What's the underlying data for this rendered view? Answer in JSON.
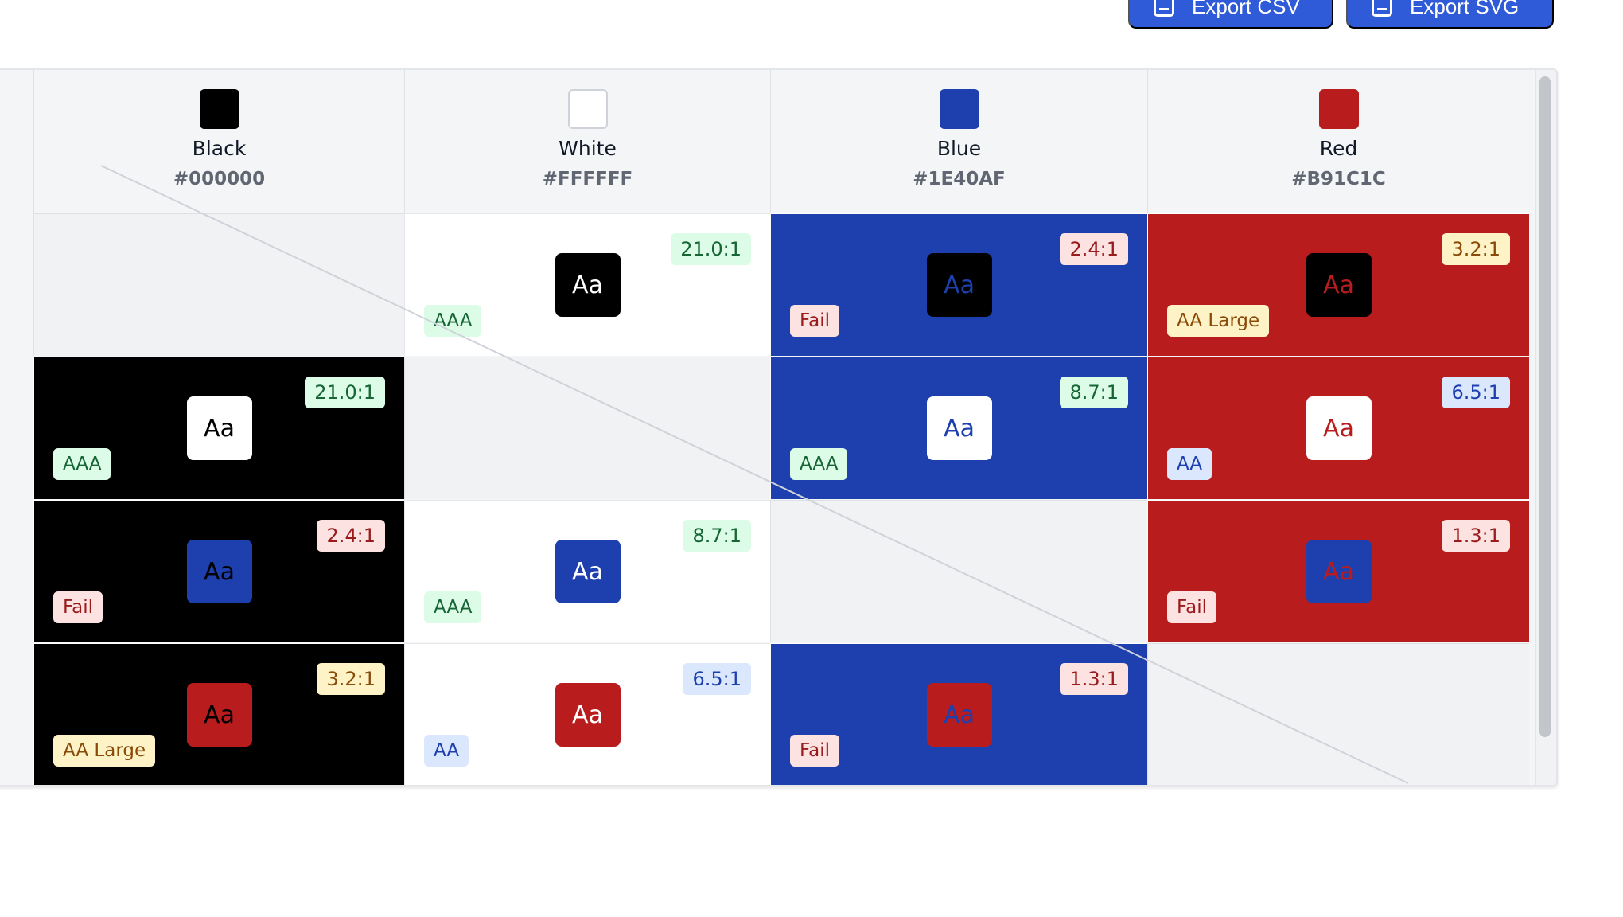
{
  "toolbar": {
    "export_csv_label": "Export CSV",
    "export_svg_label": "Export SVG"
  },
  "sample_text": "Aa",
  "columns": [
    {
      "name": "Black",
      "hex": "#000000"
    },
    {
      "name": "White",
      "hex": "#FFFFFF"
    },
    {
      "name": "Blue",
      "hex": "#1E40AF"
    },
    {
      "name": "Red",
      "hex": "#B91C1C"
    }
  ],
  "rows": [
    {
      "text_color": "Black",
      "cells": [
        {
          "ratio": null,
          "level": null
        },
        {
          "ratio": "21.0:1",
          "level": "AAA",
          "status": "pass"
        },
        {
          "ratio": "2.4:1",
          "level": "Fail",
          "status": "fail"
        },
        {
          "ratio": "3.2:1",
          "level": "AA Large",
          "status": "large"
        }
      ]
    },
    {
      "text_color": "White",
      "cells": [
        {
          "ratio": "21.0:1",
          "level": "AAA",
          "status": "pass"
        },
        {
          "ratio": null,
          "level": null
        },
        {
          "ratio": "8.7:1",
          "level": "AAA",
          "status": "pass"
        },
        {
          "ratio": "6.5:1",
          "level": "AA",
          "status": "aa"
        }
      ]
    },
    {
      "text_color": "Blue",
      "cells": [
        {
          "ratio": "2.4:1",
          "level": "Fail",
          "status": "fail"
        },
        {
          "ratio": "8.7:1",
          "level": "AAA",
          "status": "pass"
        },
        {
          "ratio": null,
          "level": null
        },
        {
          "ratio": "1.3:1",
          "level": "Fail",
          "status": "fail"
        }
      ]
    },
    {
      "text_color": "Red",
      "cells": [
        {
          "ratio": "3.2:1",
          "level": "AA Large",
          "status": "large"
        },
        {
          "ratio": "6.5:1",
          "level": "AA",
          "status": "aa"
        },
        {
          "ratio": "1.3:1",
          "level": "Fail",
          "status": "fail"
        },
        {
          "ratio": null,
          "level": null
        }
      ]
    }
  ]
}
